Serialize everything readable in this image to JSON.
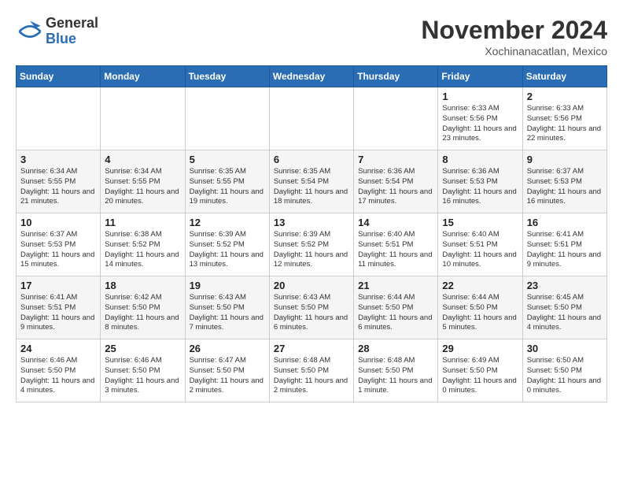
{
  "logo": {
    "name_line1": "General",
    "name_line2": "Blue"
  },
  "title": "November 2024",
  "location": "Xochinanacatlan, Mexico",
  "weekdays": [
    "Sunday",
    "Monday",
    "Tuesday",
    "Wednesday",
    "Thursday",
    "Friday",
    "Saturday"
  ],
  "weeks": [
    [
      {
        "day": "",
        "info": ""
      },
      {
        "day": "",
        "info": ""
      },
      {
        "day": "",
        "info": ""
      },
      {
        "day": "",
        "info": ""
      },
      {
        "day": "",
        "info": ""
      },
      {
        "day": "1",
        "info": "Sunrise: 6:33 AM\nSunset: 5:56 PM\nDaylight: 11 hours and 23 minutes."
      },
      {
        "day": "2",
        "info": "Sunrise: 6:33 AM\nSunset: 5:56 PM\nDaylight: 11 hours and 22 minutes."
      }
    ],
    [
      {
        "day": "3",
        "info": "Sunrise: 6:34 AM\nSunset: 5:55 PM\nDaylight: 11 hours and 21 minutes."
      },
      {
        "day": "4",
        "info": "Sunrise: 6:34 AM\nSunset: 5:55 PM\nDaylight: 11 hours and 20 minutes."
      },
      {
        "day": "5",
        "info": "Sunrise: 6:35 AM\nSunset: 5:55 PM\nDaylight: 11 hours and 19 minutes."
      },
      {
        "day": "6",
        "info": "Sunrise: 6:35 AM\nSunset: 5:54 PM\nDaylight: 11 hours and 18 minutes."
      },
      {
        "day": "7",
        "info": "Sunrise: 6:36 AM\nSunset: 5:54 PM\nDaylight: 11 hours and 17 minutes."
      },
      {
        "day": "8",
        "info": "Sunrise: 6:36 AM\nSunset: 5:53 PM\nDaylight: 11 hours and 16 minutes."
      },
      {
        "day": "9",
        "info": "Sunrise: 6:37 AM\nSunset: 5:53 PM\nDaylight: 11 hours and 16 minutes."
      }
    ],
    [
      {
        "day": "10",
        "info": "Sunrise: 6:37 AM\nSunset: 5:53 PM\nDaylight: 11 hours and 15 minutes."
      },
      {
        "day": "11",
        "info": "Sunrise: 6:38 AM\nSunset: 5:52 PM\nDaylight: 11 hours and 14 minutes."
      },
      {
        "day": "12",
        "info": "Sunrise: 6:39 AM\nSunset: 5:52 PM\nDaylight: 11 hours and 13 minutes."
      },
      {
        "day": "13",
        "info": "Sunrise: 6:39 AM\nSunset: 5:52 PM\nDaylight: 11 hours and 12 minutes."
      },
      {
        "day": "14",
        "info": "Sunrise: 6:40 AM\nSunset: 5:51 PM\nDaylight: 11 hours and 11 minutes."
      },
      {
        "day": "15",
        "info": "Sunrise: 6:40 AM\nSunset: 5:51 PM\nDaylight: 11 hours and 10 minutes."
      },
      {
        "day": "16",
        "info": "Sunrise: 6:41 AM\nSunset: 5:51 PM\nDaylight: 11 hours and 9 minutes."
      }
    ],
    [
      {
        "day": "17",
        "info": "Sunrise: 6:41 AM\nSunset: 5:51 PM\nDaylight: 11 hours and 9 minutes."
      },
      {
        "day": "18",
        "info": "Sunrise: 6:42 AM\nSunset: 5:50 PM\nDaylight: 11 hours and 8 minutes."
      },
      {
        "day": "19",
        "info": "Sunrise: 6:43 AM\nSunset: 5:50 PM\nDaylight: 11 hours and 7 minutes."
      },
      {
        "day": "20",
        "info": "Sunrise: 6:43 AM\nSunset: 5:50 PM\nDaylight: 11 hours and 6 minutes."
      },
      {
        "day": "21",
        "info": "Sunrise: 6:44 AM\nSunset: 5:50 PM\nDaylight: 11 hours and 6 minutes."
      },
      {
        "day": "22",
        "info": "Sunrise: 6:44 AM\nSunset: 5:50 PM\nDaylight: 11 hours and 5 minutes."
      },
      {
        "day": "23",
        "info": "Sunrise: 6:45 AM\nSunset: 5:50 PM\nDaylight: 11 hours and 4 minutes."
      }
    ],
    [
      {
        "day": "24",
        "info": "Sunrise: 6:46 AM\nSunset: 5:50 PM\nDaylight: 11 hours and 4 minutes."
      },
      {
        "day": "25",
        "info": "Sunrise: 6:46 AM\nSunset: 5:50 PM\nDaylight: 11 hours and 3 minutes."
      },
      {
        "day": "26",
        "info": "Sunrise: 6:47 AM\nSunset: 5:50 PM\nDaylight: 11 hours and 2 minutes."
      },
      {
        "day": "27",
        "info": "Sunrise: 6:48 AM\nSunset: 5:50 PM\nDaylight: 11 hours and 2 minutes."
      },
      {
        "day": "28",
        "info": "Sunrise: 6:48 AM\nSunset: 5:50 PM\nDaylight: 11 hours and 1 minute."
      },
      {
        "day": "29",
        "info": "Sunrise: 6:49 AM\nSunset: 5:50 PM\nDaylight: 11 hours and 0 minutes."
      },
      {
        "day": "30",
        "info": "Sunrise: 6:50 AM\nSunset: 5:50 PM\nDaylight: 11 hours and 0 minutes."
      }
    ]
  ]
}
